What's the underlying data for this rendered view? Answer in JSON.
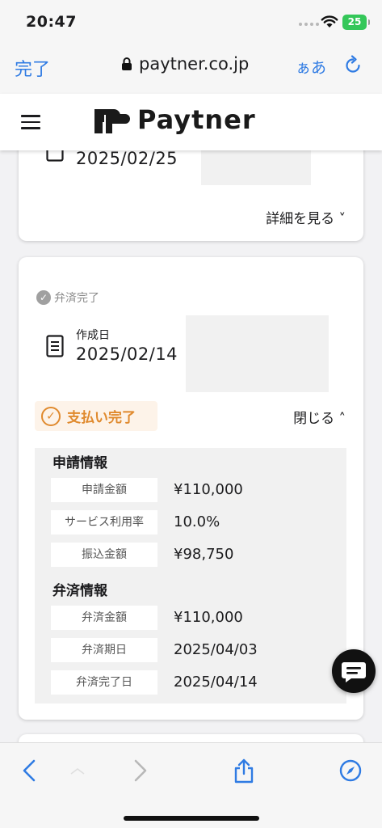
{
  "status_bar": {
    "time": "20:47",
    "battery": "25"
  },
  "browser": {
    "done_label": "完了",
    "url": "paytner.co.jp",
    "text_size_label": "ぁあ"
  },
  "site": {
    "logo_text": "Paytner"
  },
  "card1": {
    "date": "2025/02/25",
    "detail_link": "詳細を見る ˅"
  },
  "card2": {
    "status_badge": "弁済完了",
    "created_label": "作成日",
    "created_date": "2025/02/14",
    "payment_status": "支払い完了",
    "close_link": "閉じる ˄",
    "application": {
      "title": "申請情報",
      "rows": [
        {
          "label": "申請金額",
          "value": "¥110,000"
        },
        {
          "label": "サービス利用率",
          "value": "10.0%"
        },
        {
          "label": "振込金額",
          "value": "¥98,750"
        }
      ]
    },
    "repayment": {
      "title": "弁済情報",
      "rows": [
        {
          "label": "弁済金額",
          "value": "¥110,000"
        },
        {
          "label": "弁済期日",
          "value": "2025/04/03"
        },
        {
          "label": "弁済完了日",
          "value": "2025/04/14"
        }
      ]
    }
  },
  "colors": {
    "accent_blue": "#2f7be3",
    "orange": "#e08a2e",
    "battery_green": "#34c759"
  }
}
